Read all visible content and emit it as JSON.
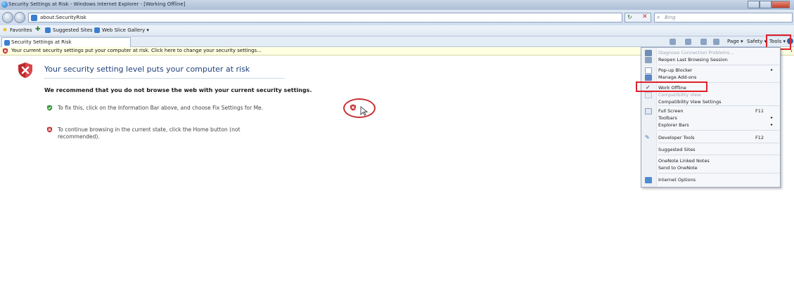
{
  "window": {
    "title": "Security Settings at Risk - Windows Internet Explorer - [Working Offline]"
  },
  "address_bar": {
    "url": "about:SecurityRisk",
    "search_placeholder": "Bing"
  },
  "favorites_bar": {
    "favorites_label": "Favorites",
    "suggested_sites_label": "Suggested Sites ▾",
    "web_slice_gallery_label": "Web Slice Gallery ▾"
  },
  "tab": {
    "label": "Security Settings at Risk"
  },
  "command_bar": {
    "page_label": "Page ▾",
    "safety_label": "Safety ▾",
    "tools_label": "Tools ▾"
  },
  "info_bar": {
    "text": "Your current security settings put your computer at risk. Click here to change your security settings..."
  },
  "content": {
    "heading": "Your security setting level puts your computer at risk",
    "recommend": "We recommend that you do not browse the web with your current security settings.",
    "bullet1": "To fix this, click on the Information Bar above, and choose Fix Settings for Me.",
    "bullet2": "To continue browsing in the current state, click the Home button (not recommended)."
  },
  "tools_menu": {
    "items": [
      {
        "label": "Diagnose Connection Problems...",
        "disabled": true
      },
      {
        "label": "Reopen Last Browsing Session"
      },
      {
        "label": "Pop-up Blocker",
        "submenu": true
      },
      {
        "label": "Manage Add-ons"
      },
      {
        "label": "Work Offline",
        "checked": true
      },
      {
        "label": "Compatibility View",
        "disabled": true
      },
      {
        "label": "Compatibility View Settings"
      },
      {
        "label": "Full Screen",
        "shortcut": "F11"
      },
      {
        "label": "Toolbars",
        "submenu": true
      },
      {
        "label": "Explorer Bars",
        "submenu": true
      },
      {
        "label": "Developer Tools",
        "shortcut": "F12"
      },
      {
        "label": "Suggested Sites"
      },
      {
        "label": "OneNote Linked Notes"
      },
      {
        "label": "Send to OneNote"
      },
      {
        "label": "Internet Options"
      }
    ]
  },
  "colors": {
    "highlight_red": "#e0202a",
    "heading_blue": "#1f3f7a",
    "info_bar_bg": "#ffffe1"
  }
}
